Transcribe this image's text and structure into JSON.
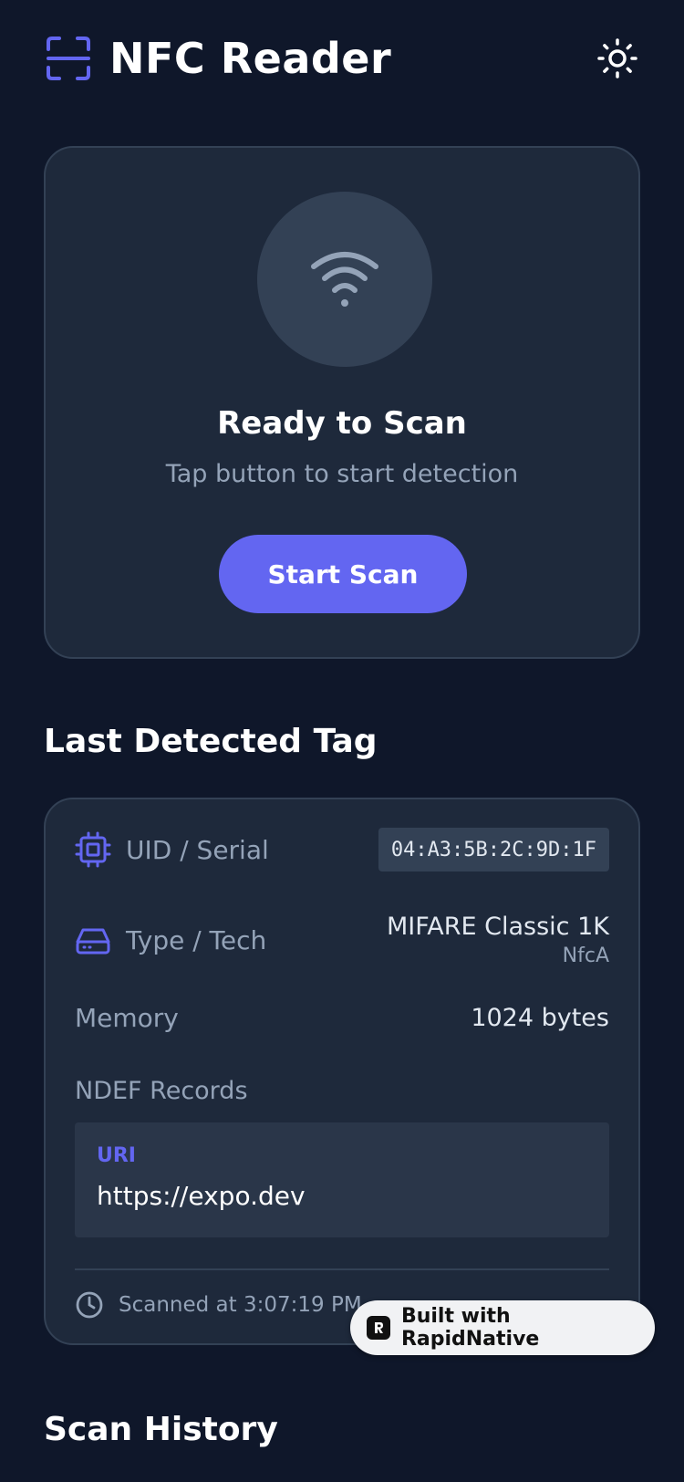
{
  "header": {
    "title": "NFC Reader",
    "logo_icon": "scan-frame-icon",
    "theme_icon": "sun-icon",
    "accent_color": "#6366f1"
  },
  "scan_card": {
    "icon": "wifi-signal-icon",
    "title": "Ready to Scan",
    "subtitle": "Tap button to start detection",
    "button_label": "Start Scan"
  },
  "last_tag": {
    "section_title": "Last Detected Tag",
    "uid_label": "UID / Serial",
    "uid_value": "04:A3:5B:2C:9D:1F",
    "type_label": "Type / Tech",
    "type_value": "MIFARE Classic 1K",
    "tech_value": "NfcA",
    "memory_label": "Memory",
    "memory_value": "1024 bytes",
    "ndef_label": "NDEF Records",
    "record": {
      "type": "URI",
      "value": "https://expo.dev"
    },
    "scanned_text": "Scanned at 3:07:19 PM"
  },
  "history": {
    "section_title": "Scan History"
  },
  "badge": {
    "label": "Built with RapidNative"
  }
}
